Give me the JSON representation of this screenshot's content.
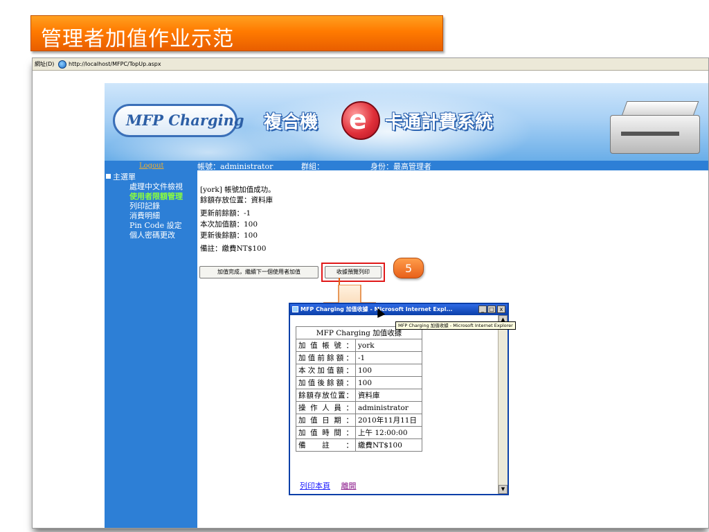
{
  "slide_title": "管理者加值作业示范",
  "browser": {
    "address_label": "網址(D)",
    "url": "http://localhost/MFPC/TopUp.aspx"
  },
  "header": {
    "logo_text": "MFP Charging",
    "brand_left": "複合機",
    "brand_badge": "e",
    "brand_right": "卡通計費系統"
  },
  "sidebar": {
    "logout": "Logout",
    "menu_title": "主選單",
    "items": [
      {
        "label": "處理中文件檢視"
      },
      {
        "label": "使用者限額管理"
      },
      {
        "label": "列印記錄"
      },
      {
        "label": "消費明細"
      },
      {
        "label": "Pin Code 設定"
      },
      {
        "label": "個人密碼更改"
      }
    ]
  },
  "infobar": {
    "account": "帳號：administrator",
    "group": "群組：",
    "role": "身份：最高管理者"
  },
  "result": {
    "lines": [
      "[york] 帳號加值成功。",
      "餘額存放位置：資料庫",
      "更新前餘額：-1",
      "本次加值額：100",
      "更新後餘額：100",
      "備註：繳費NT$100"
    ],
    "btn_next": "加值完成，繼續下一個使用者加值",
    "btn_print": "收據預覽列印"
  },
  "callout": "5",
  "popup": {
    "title": "MFP Charging 加值收據 - Microsoft Internet Expl...",
    "btn_min": "_",
    "btn_max": "□",
    "btn_close": "x",
    "caption": "MFP Charging 加值收據",
    "rows": [
      {
        "k": "加值帳號：",
        "v": "york"
      },
      {
        "k": "加值前餘額：",
        "v": "-1"
      },
      {
        "k": "本次加值額：",
        "v": "100"
      },
      {
        "k": "加值後餘額：",
        "v": "100"
      },
      {
        "k": "餘額存放位置：",
        "v": "資料庫"
      },
      {
        "k": "操作人員：",
        "v": "administrator"
      },
      {
        "k": "加值日期：",
        "v": "2010年11月11日"
      },
      {
        "k": "加值時間：",
        "v": "上午 12:00:00"
      },
      {
        "k": "備註：",
        "v": "繳費NT$100"
      }
    ],
    "link_print": "列印本頁",
    "link_close": "離開"
  },
  "tooltip": "MFP Charging 加值收據 - Microsoft Internet Explorer"
}
